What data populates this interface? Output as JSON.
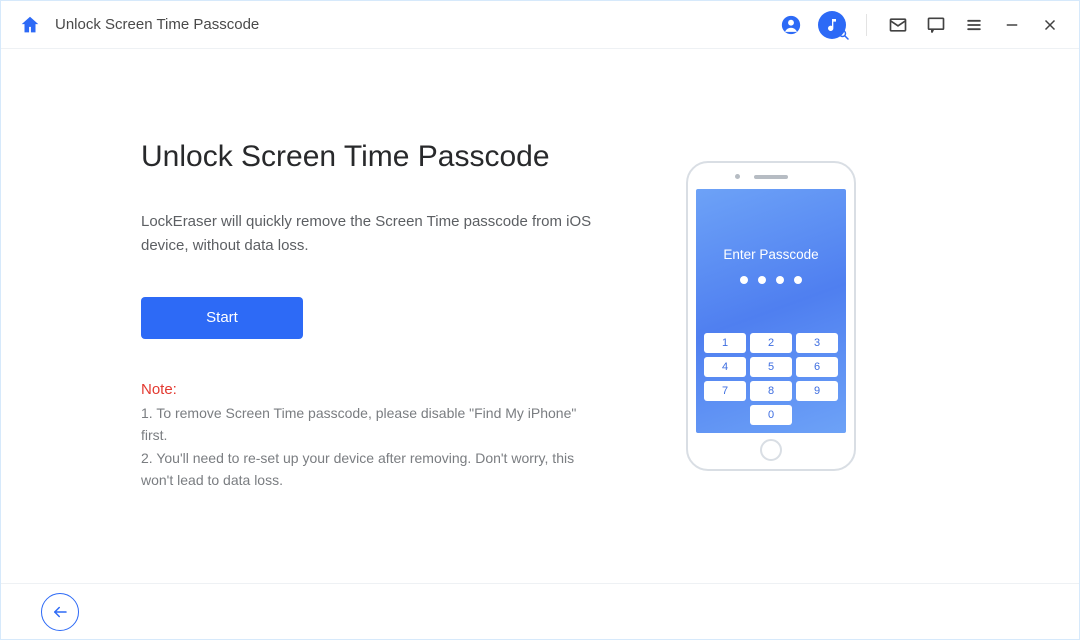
{
  "titlebar": {
    "title": "Unlock Screen Time Passcode"
  },
  "main": {
    "heading": "Unlock Screen Time Passcode",
    "description": "LockEraser will quickly remove the Screen Time passcode from iOS device, without data loss.",
    "start_label": "Start",
    "note_label": "Note:",
    "note_1": "1. To remove Screen Time passcode, please disable \"Find My iPhone\" first.",
    "note_2": "2. You'll need to re-set up your device after removing. Don't worry, this won't lead to data loss."
  },
  "phone": {
    "passcode_label": "Enter Passcode",
    "keys": [
      "1",
      "2",
      "3",
      "4",
      "5",
      "6",
      "7",
      "8",
      "9",
      "0"
    ]
  }
}
